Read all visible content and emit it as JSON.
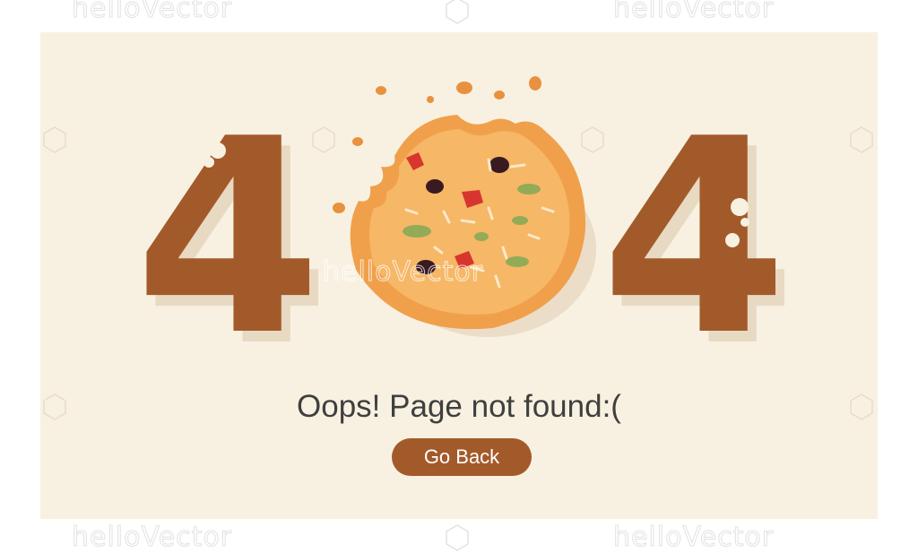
{
  "watermark": {
    "brand": "helloVector"
  },
  "error": {
    "digit_left": "4",
    "digit_right": "4",
    "message": "Oops! Page not found:(",
    "button_label": "Go Back"
  },
  "colors": {
    "background": "#f8f1e1",
    "digit": "#a35a2a",
    "button": "#a35a2a",
    "message_text": "#3f3f3f",
    "cookie": "#f0a04b"
  },
  "icons": [
    "cookie-icon",
    "watermark-logo-icon"
  ]
}
